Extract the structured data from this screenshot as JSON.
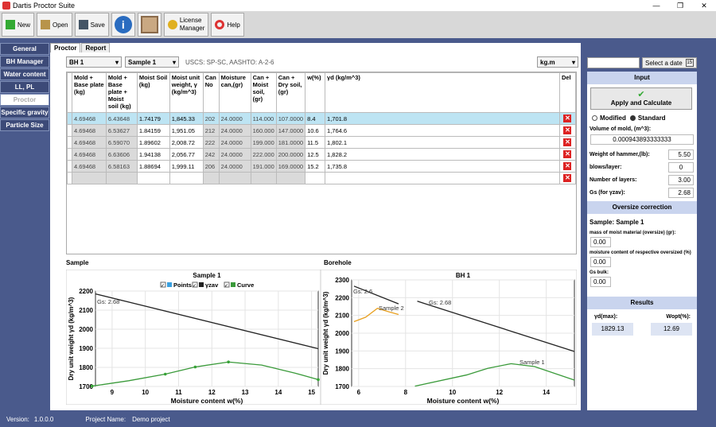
{
  "app": {
    "title": "Dartis Proctor Suite"
  },
  "toolbar": {
    "new_label": "New",
    "open_label": "Open",
    "save_label": "Save",
    "license_label_1": "License",
    "license_label_2": "Manager",
    "help_label": "Help"
  },
  "sidebar": {
    "items": [
      "General",
      "BH Manager",
      "Water content",
      "LL, PL",
      "Proctor",
      "Specific gravity",
      "Particle Size"
    ]
  },
  "tabs": [
    "Proctor",
    "Report"
  ],
  "selectors": {
    "borehole": "BH 1",
    "sample": "Sample 1",
    "units": "kg.m"
  },
  "soil_class": "USCS: SP-SC, AASHTO: A-2-6",
  "table": {
    "headers": [
      "Mold + Base plate (kg)",
      "Mold + Base plate + Moist soil (kg)",
      "Moist Soil (kg)",
      "Moist unit weight, γ (kg/m^3)",
      "Can No",
      "Moisture can,(gr)",
      "Can + Moist soil, (gr)",
      "Can + Dry soil, (gr)",
      "w(%)",
      "γd (kg/m^3)",
      "Del"
    ],
    "rows": [
      [
        "4.69468",
        "6.43648",
        "1.74179",
        "1,845.33",
        "202",
        "24.0000",
        "114.000",
        "107.0000",
        "8.4",
        "1,701.8"
      ],
      [
        "4.69468",
        "6.53627",
        "1.84159",
        "1,951.05",
        "212",
        "24.0000",
        "160.000",
        "147.0000",
        "10.6",
        "1,764.6"
      ],
      [
        "4.69468",
        "6.59070",
        "1.89602",
        "2,008.72",
        "222",
        "24.0000",
        "199.000",
        "181.0000",
        "11.5",
        "1,802.1"
      ],
      [
        "4.69468",
        "6.63606",
        "1.94138",
        "2,056.77",
        "242",
        "24.0000",
        "222.000",
        "200.0000",
        "12.5",
        "1,828.2"
      ],
      [
        "4.69468",
        "6.58163",
        "1.88694",
        "1,999.11",
        "206",
        "24.0000",
        "191.000",
        "169.0000",
        "15.2",
        "1,735.8"
      ]
    ]
  },
  "labels": {
    "sample": "Sample",
    "borehole": "Borehole"
  },
  "chart_data": [
    {
      "type": "line",
      "title": "Sample 1",
      "xlabel": "Moisture content w(%)",
      "ylabel": "Dry unit weight γd (kg/m^3)",
      "xlim": [
        8.5,
        15.2
      ],
      "ylim": [
        1700,
        2200
      ],
      "xticks": [
        9,
        10,
        11,
        12,
        13,
        14,
        15
      ],
      "yticks": [
        1700,
        1800,
        1900,
        2000,
        2100,
        2200
      ],
      "legend": [
        "Points",
        "γzav",
        "Curve"
      ],
      "annotations": [
        "Gs: 2.68"
      ],
      "series": [
        {
          "name": "Points",
          "x": [
            8.4,
            10.6,
            11.5,
            12.5,
            15.2
          ],
          "y": [
            1701.8,
            1764.6,
            1802.1,
            1828.2,
            1735.8
          ]
        },
        {
          "name": "γzav",
          "x": [
            8.5,
            15.2
          ],
          "y": [
            2185,
            1898
          ]
        },
        {
          "name": "Curve",
          "x": [
            8.4,
            9.5,
            10.6,
            11.5,
            12.5,
            13.5,
            14.5,
            15.2
          ],
          "y": [
            1701.8,
            1730,
            1764.6,
            1802.1,
            1828.2,
            1812,
            1770,
            1735.8
          ]
        }
      ]
    },
    {
      "type": "line",
      "title": "BH 1",
      "xlabel": "Moisture content w(%)",
      "ylabel": "Dry unit weight γd (kg/m^3)",
      "xlim": [
        5.7,
        15.2
      ],
      "ylim": [
        1700,
        2300
      ],
      "xticks": [
        6,
        8,
        10,
        12,
        14
      ],
      "yticks": [
        1700,
        1800,
        1900,
        2000,
        2100,
        2200,
        2300
      ],
      "annotations": [
        "Gs: 2.6",
        "Gs: 2.68",
        "Sample 2",
        "Sample 1"
      ],
      "series": [
        {
          "name": "Sample 2",
          "x": [
            5.8,
            6.3,
            6.8,
            7.3,
            7.7
          ],
          "y": [
            2065,
            2090,
            2140,
            2120,
            2105
          ]
        },
        {
          "name": "Sample 2 γzav",
          "x": [
            5.8,
            7.7
          ],
          "y": [
            2265,
            2165
          ]
        },
        {
          "name": "Sample 1",
          "x": [
            8.4,
            10.6,
            11.5,
            12.5,
            13.5,
            15.2
          ],
          "y": [
            1701.8,
            1764.6,
            1802.1,
            1828.2,
            1812,
            1735.8
          ]
        },
        {
          "name": "Sample 1 γzav",
          "x": [
            8.5,
            15.2
          ],
          "y": [
            2180,
            1897
          ]
        }
      ]
    }
  ],
  "right": {
    "date_label": "Select a date",
    "input_header": "Input",
    "apply_label": "Apply and Calculate",
    "modified_label": "Modified",
    "standard_label": "Standard",
    "volume_label": "Volume of mold, (m^3):",
    "volume_value": "0.000943893333333",
    "hammer_label": "Weight of hammer,(lb):",
    "hammer_value": "5.50",
    "blows_label": "blows/layer:",
    "blows_value": "0",
    "layers_label": "Number of layers:",
    "layers_value": "3.00",
    "gs_label": "Gs (for γzav):",
    "gs_value": "2.68",
    "oversize_header": "Oversize correction",
    "sample_text": "Sample:   Sample 1",
    "mass_label": "mass of moist material (oversize) (gr):",
    "mass_value": "0.00",
    "moist_label": "moisture content of respective oversized (%)",
    "moist_value": "0.00",
    "gsbulk_label": "Gs bulk:",
    "gsbulk_value": "0.00",
    "results_header": "Results",
    "ydmax_label": "γd(max):",
    "wopt_label": "Wopt(%):",
    "ydmax_value": "1829.13",
    "wopt_value": "12.69"
  },
  "status": {
    "version_label": "Version:",
    "version": "1.0.0.0",
    "project_label": "Project Name:",
    "project": "Demo project"
  }
}
